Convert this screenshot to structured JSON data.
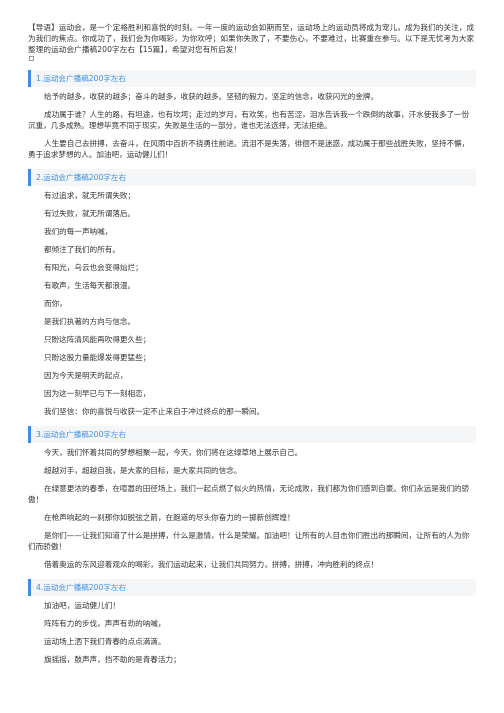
{
  "intro": "【导语】运动会，是一个定格胜利和喜悦的时刻。一年一度的运动会如期而至，运动场上的运动员将成为宠儿，成为我们的关注，成为我们的焦点。你成功了，我们会为你喝彩，为你欢呼；如果你失败了，不要伤心，不要难过，比赛重在参与。以下是无忧考为大家整理的运动会广播稿200字左右【15篇】，希望对您有所启发！",
  "accent_color": "#3c8fe8",
  "sections": [
    {
      "title": "1.运动会广播稿200字左右",
      "paragraphs": [
        "给予的越多，收获的越多；奋斗的越多，收获的越多。坚韧的毅力，坚定的信念，收获闪光的金牌。",
        "成功属于谁？人生的路，有坦途，也有坎坷；走过的岁月，有欢笑，也有苦涩，泪水告诉我一个跌倒的故事，汗水使我多了一份沉重，几多成熟。理想毕竟不同于现实，失败是生活的一部分，谁也无法选择，无法拒绝。",
        "人生要自己去拼搏，去奋斗，在风雨中百折不挠勇往前进。流泪不是失落，徘徊不是迷惑，成功属于那些战胜失败，坚持不懈，勇于追求梦想的人。加油吧，运动健儿们！"
      ]
    },
    {
      "title": "2.运动会广播稿200字左右",
      "paragraphs": [
        "有过追求，就无所谓失败；",
        "有过失败，就无所谓落后。",
        "我们的每一声呐喊，",
        "都倾注了我们的所有。",
        "有阳光，乌云也会变得灿烂；",
        "有歌声，生活每天都浪漫。",
        "而你，",
        "是我们执著的方向与信念。",
        "只盼这阵清风能再吹得更久些；",
        "只盼这股力量能爆发得更猛些；",
        "因为今天是明天的起点，",
        "因为这一刻早已与下一刻相恋，",
        "我们坚信：你的喜悦与收获一定不止来自于冲过终点的那一瞬间。"
      ]
    },
    {
      "title": "3.运动会广播稿200字左右",
      "paragraphs": [
        "今天，我们怀着共同的梦想相聚一起，今天，你们将在这绿草地上展示自己。",
        "超越对手，超越自我，是大家的目标，是大家共同的信念。",
        "在绿意更浓的春季，在喧嚣的田径场上，我们一起点燃了似火的热情，无论成败，我们都为你们感到自豪。你们永远是我们的骄傲！",
        "在枪声响起的一刹那你如脱弦之箭，在跑道的尽头你奋力的一掷新创辉煌！",
        "是你们——让我们知道了什么是拼搏，什么是激情，什么是荣耀。加油吧！让所有的人目击你们胜出的那瞬间，让所有的人为你们而骄傲！",
        "借着奥运的东风迎着观众的喝彩，我们运动起来，让我们共同努力，拼搏，拼搏，冲向胜利的终点！"
      ]
    },
    {
      "title": "4.运动会广播稿200字左右",
      "paragraphs": [
        "加油吧，运动健儿们！",
        "阵阵有力的步伐，声声有劲的呐喊，",
        "运动场上洒下我们青春的点点滴滴。",
        "旗摇摇，鼓声声，挡不助的是青春活力；"
      ]
    }
  ]
}
